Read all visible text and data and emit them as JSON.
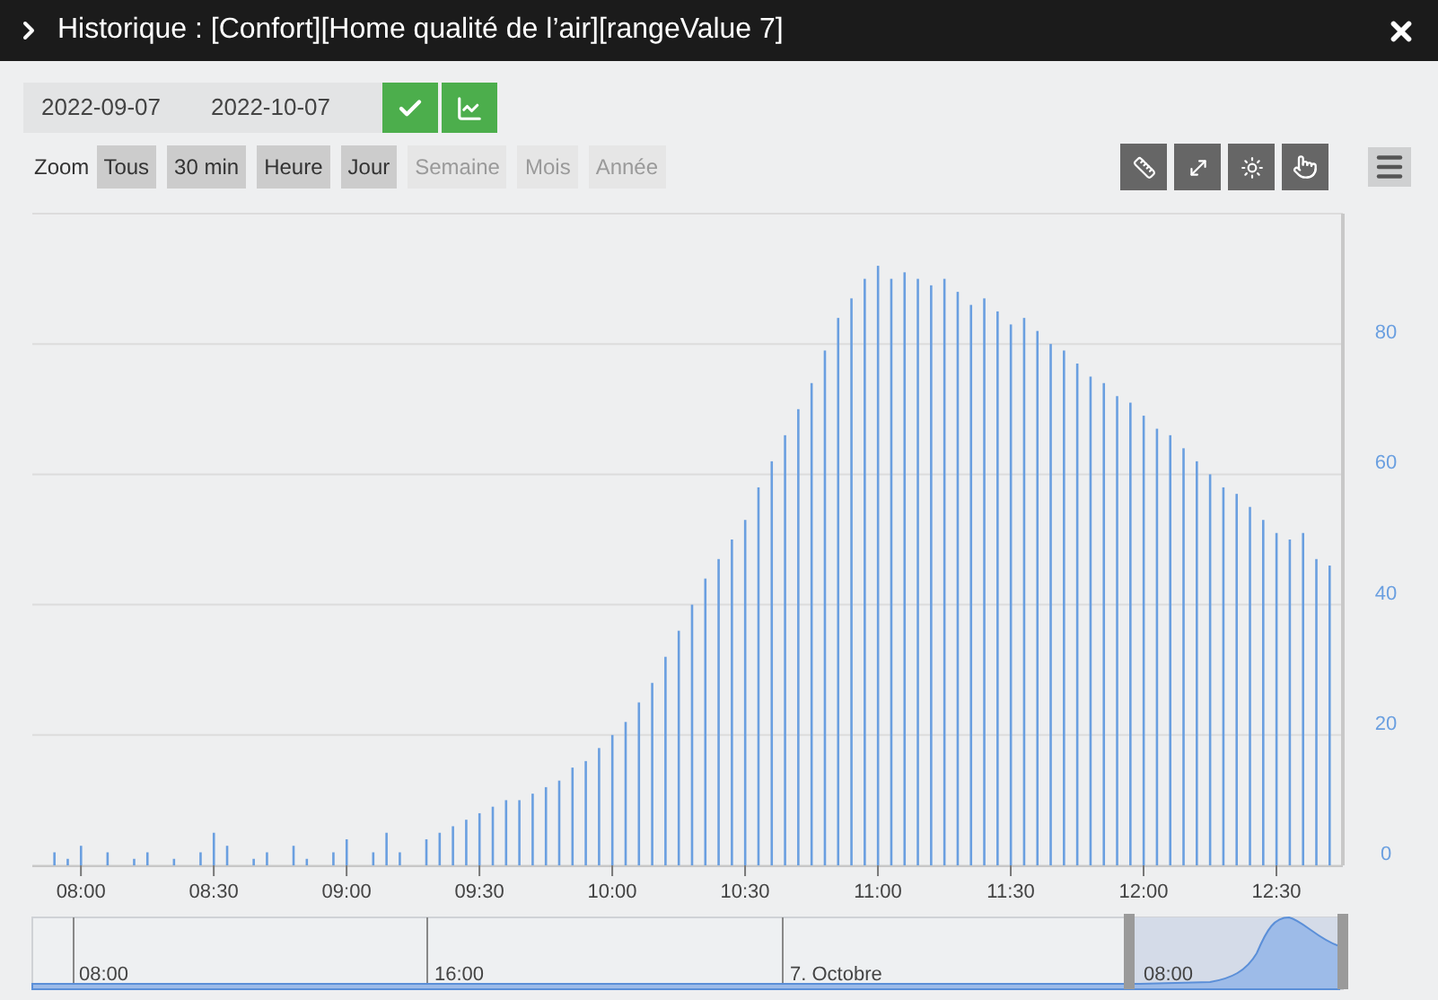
{
  "window": {
    "title": "Historique : [Confort][Home qualité de l’air][rangeValue 7]"
  },
  "dates": {
    "start": "2022-09-07",
    "end": "2022-10-07"
  },
  "zoom": {
    "label": "Zoom",
    "buttons": [
      {
        "label": "Tous",
        "disabled": false
      },
      {
        "label": "30 min",
        "disabled": false
      },
      {
        "label": "Heure",
        "disabled": false
      },
      {
        "label": "Jour",
        "disabled": false
      },
      {
        "label": "Semaine",
        "disabled": true
      },
      {
        "label": "Mois",
        "disabled": true
      },
      {
        "label": "Année",
        "disabled": true
      }
    ]
  },
  "chart": {
    "chart_data": {
      "type": "bar",
      "categories": [
        null,
        null,
        "08:00",
        null,
        null,
        null,
        null,
        null,
        null,
        null,
        null,
        null,
        "08:30",
        null,
        null,
        null,
        null,
        null,
        null,
        null,
        null,
        null,
        "09:00",
        null,
        null,
        null,
        null,
        null,
        null,
        null,
        null,
        null,
        "09:30",
        null,
        null,
        null,
        null,
        null,
        null,
        null,
        null,
        null,
        "10:00",
        null,
        null,
        null,
        null,
        null,
        null,
        null,
        null,
        null,
        "10:30",
        null,
        null,
        null,
        null,
        null,
        null,
        null,
        null,
        null,
        "11:00",
        null,
        null,
        null,
        null,
        null,
        null,
        null,
        null,
        null,
        "11:30",
        null,
        null,
        null,
        null,
        null,
        null,
        null,
        null,
        null,
        "12:00",
        null,
        null,
        null,
        null,
        null,
        null,
        null,
        null,
        null,
        "12:30",
        null,
        null,
        null,
        null
      ],
      "series": [
        {
          "color": "#6a9fe0",
          "values": [
            2,
            1,
            3,
            null,
            2,
            null,
            1,
            2,
            null,
            1,
            null,
            2,
            5,
            3,
            null,
            1,
            2,
            null,
            3,
            1,
            null,
            2,
            4,
            null,
            2,
            5,
            2,
            null,
            4,
            5,
            6,
            7,
            8,
            9,
            10,
            10,
            11,
            12,
            13,
            15,
            16,
            18,
            20,
            22,
            25,
            28,
            32,
            36,
            40,
            44,
            47,
            50,
            53,
            58,
            62,
            66,
            70,
            74,
            79,
            84,
            87,
            90,
            92,
            90,
            91,
            90,
            89,
            90,
            88,
            86,
            87,
            85,
            83,
            84,
            82,
            80,
            79,
            77,
            75,
            74,
            72,
            71,
            69,
            67,
            66,
            64,
            62,
            60,
            58,
            57,
            55,
            53,
            51,
            50,
            51,
            47,
            46
          ]
        }
      ],
      "ylim": [
        0,
        100
      ],
      "grid": true,
      "yticks": [
        0,
        20,
        40,
        60,
        80
      ]
    },
    "navigator": {
      "labels": [
        "08:00",
        "16:00",
        "7. Octobre",
        "08:00"
      ]
    }
  }
}
